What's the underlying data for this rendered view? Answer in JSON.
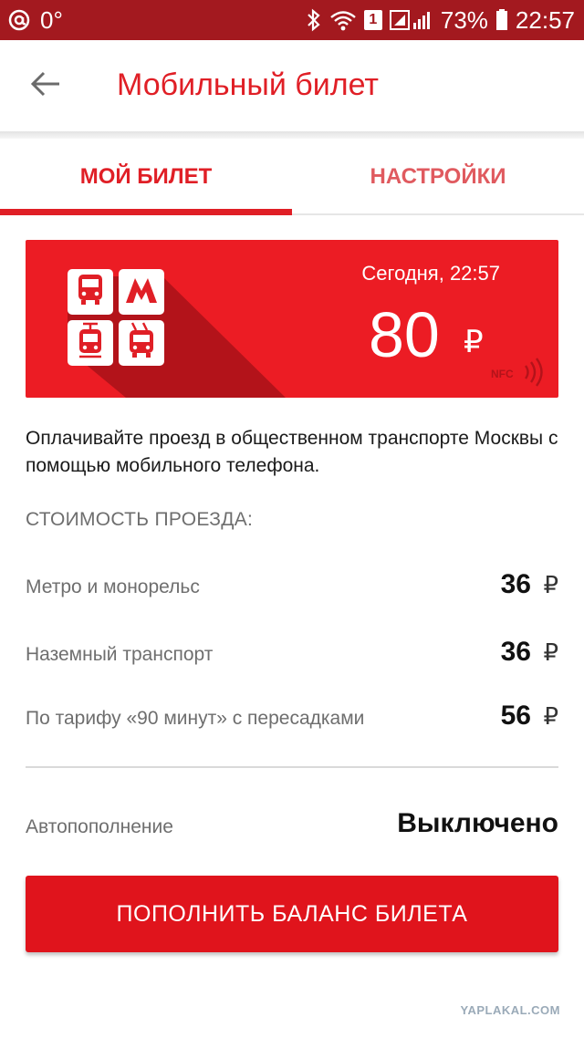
{
  "status_bar": {
    "temperature": "0°",
    "sim_slot": "1",
    "battery": "73%",
    "time": "22:57",
    "background": "#a3191f"
  },
  "app_bar": {
    "back_icon": "arrow-left-icon",
    "title": "Мобильный билет"
  },
  "tabs": [
    {
      "label": "МОЙ БИЛЕТ",
      "active": true
    },
    {
      "label": "НАСТРОЙКИ",
      "active": false
    }
  ],
  "ticket": {
    "date_time": "Сегодня, 22:57",
    "balance": "80",
    "currency": "₽",
    "nfc_label": "NFC",
    "transport_icons": [
      "bus-icon",
      "metro-icon",
      "tram-icon",
      "trolleybus-icon"
    ],
    "card_color": "#ec1c24"
  },
  "description": "Оплачивайте проезд в общественном транспорте Москвы с помощью мобильного телефона.",
  "fares": {
    "title": "СТОИМОСТЬ ПРОЕЗДА:",
    "items": [
      {
        "label": "Метро и монорельс",
        "price": "36",
        "currency": "₽"
      },
      {
        "label": "Наземный транспорт",
        "price": "36",
        "currency": "₽"
      },
      {
        "label": "По тарифу «90 минут» с пересадками",
        "price": "56",
        "currency": "₽"
      }
    ]
  },
  "autopay": {
    "label": "Автопополнение",
    "value": "Выключено"
  },
  "top_up_button": {
    "label": "ПОПОЛНИТЬ БАЛАНС БИЛЕТА",
    "color": "#e0141c"
  },
  "watermark": "YAPLAKAL.COM",
  "accent_color": "#e01f26"
}
